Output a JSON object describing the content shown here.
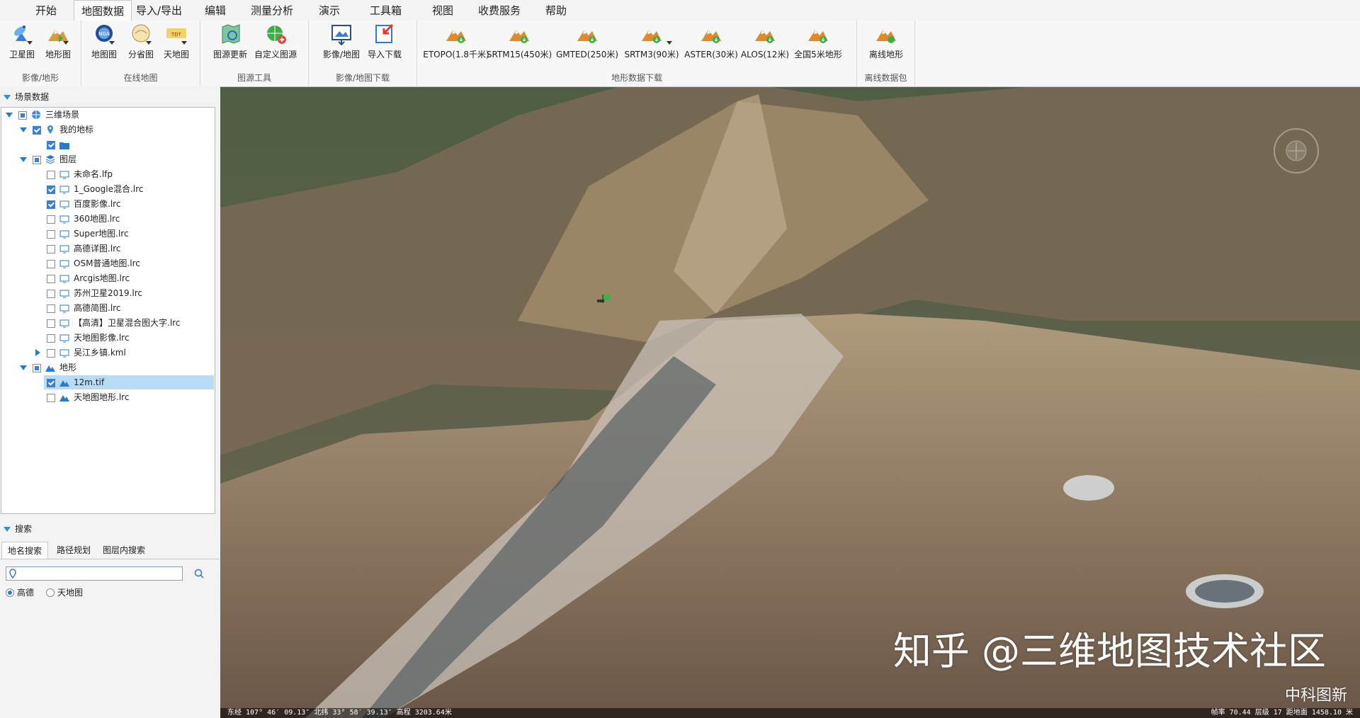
{
  "menu": [
    "开始",
    "地图数据",
    "导入/导出",
    "编辑",
    "测量分析",
    "演示",
    "工具箱",
    "视图",
    "收费服务",
    "帮助"
  ],
  "ribbon": {
    "groups": [
      {
        "label": "影像/地形",
        "buttons": [
          "卫星图",
          "地形图"
        ]
      },
      {
        "label": "在线地图",
        "buttons": [
          "地图图",
          "分省图",
          "天地图"
        ]
      },
      {
        "label": "图源工具",
        "buttons": [
          "图源更新",
          "自定义图源"
        ]
      },
      {
        "label": "影像/地图下载",
        "buttons": [
          "影像/地图",
          "导入下载"
        ]
      },
      {
        "label": "地形数据下载",
        "buttons": [
          "ETOPO(1.8千米)",
          "SRTM15(450米)",
          "GMTED(250米)",
          "SRTM3(90米)",
          "ASTER(30米)",
          "ALOS(12米)",
          "全国5米地形"
        ]
      },
      {
        "label": "离线数据包",
        "buttons": [
          "离线地形"
        ]
      }
    ]
  },
  "left_panel": {
    "scene_title": "场景数据",
    "tree": [
      {
        "label": "三维场景"
      },
      {
        "label": "我的地标"
      },
      {
        "label": ""
      },
      {
        "label": "图层"
      },
      {
        "label": "未命名.lfp"
      },
      {
        "label": "1_Google混合.lrc"
      },
      {
        "label": "百度影像.lrc"
      },
      {
        "label": "360地图.lrc"
      },
      {
        "label": "Super地图.lrc"
      },
      {
        "label": "高德详图.lrc"
      },
      {
        "label": "OSM普通地图.lrc"
      },
      {
        "label": "Arcgis地图.lrc"
      },
      {
        "label": "苏州卫星2019.lrc"
      },
      {
        "label": "高德简图.lrc"
      },
      {
        "label": "【高清】卫星混合图大字.lrc"
      },
      {
        "label": "天地图影像.lrc"
      },
      {
        "label": "吴江乡镇.kml"
      },
      {
        "label": "地形"
      },
      {
        "label": "12m.tif"
      },
      {
        "label": "天地图地形.lrc"
      }
    ],
    "search_title": "搜索",
    "tabs": [
      "地名搜索",
      "路径规划",
      "图层内搜索"
    ],
    "search_value": "",
    "radios": [
      "高德",
      "天地图"
    ]
  },
  "map": {
    "status_left": "东经 107° 46′ 09.13″  北纬 33° 58′ 39.13″  高程 3203.64米",
    "status_right": "帧率 70.44  层级 17  距地面 1458.10 米",
    "watermark": "知乎 @三维地图技术社区",
    "brand": "中科图新"
  }
}
